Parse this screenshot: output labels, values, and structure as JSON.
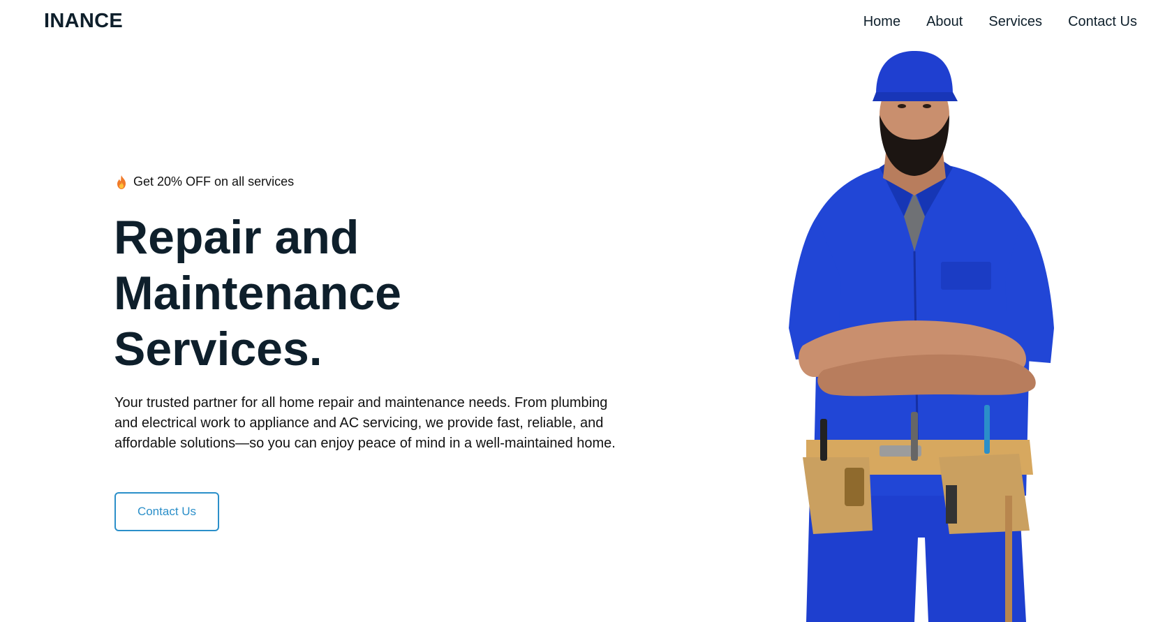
{
  "header": {
    "brand": "INANCE",
    "nav": [
      {
        "label": "Home"
      },
      {
        "label": "About"
      },
      {
        "label": "Services"
      },
      {
        "label": "Contact Us"
      }
    ]
  },
  "hero": {
    "promo": {
      "icon": "fire-icon",
      "text": "Get 20% OFF on all services"
    },
    "title": "Repair and\nMaintenance\nServices.",
    "description": "Your trusted partner for all home repair and maintenance needs. From plumbing and electrical work to appliance and AC servicing, we provide fast, reliable, and affordable solutions—so you can enjoy peace of mind in a well-maintained home.",
    "cta_label": "Contact Us"
  },
  "image": {
    "subject": "worker-photo",
    "colors": {
      "uniform": "#1e3fcf",
      "tool_belt": "#d7a85f",
      "skin": "#c98f6e",
      "beard": "#1c1512"
    }
  },
  "colors": {
    "text": "#0e1f2b",
    "accent": "#2b8fc9",
    "background": "#ffffff"
  }
}
